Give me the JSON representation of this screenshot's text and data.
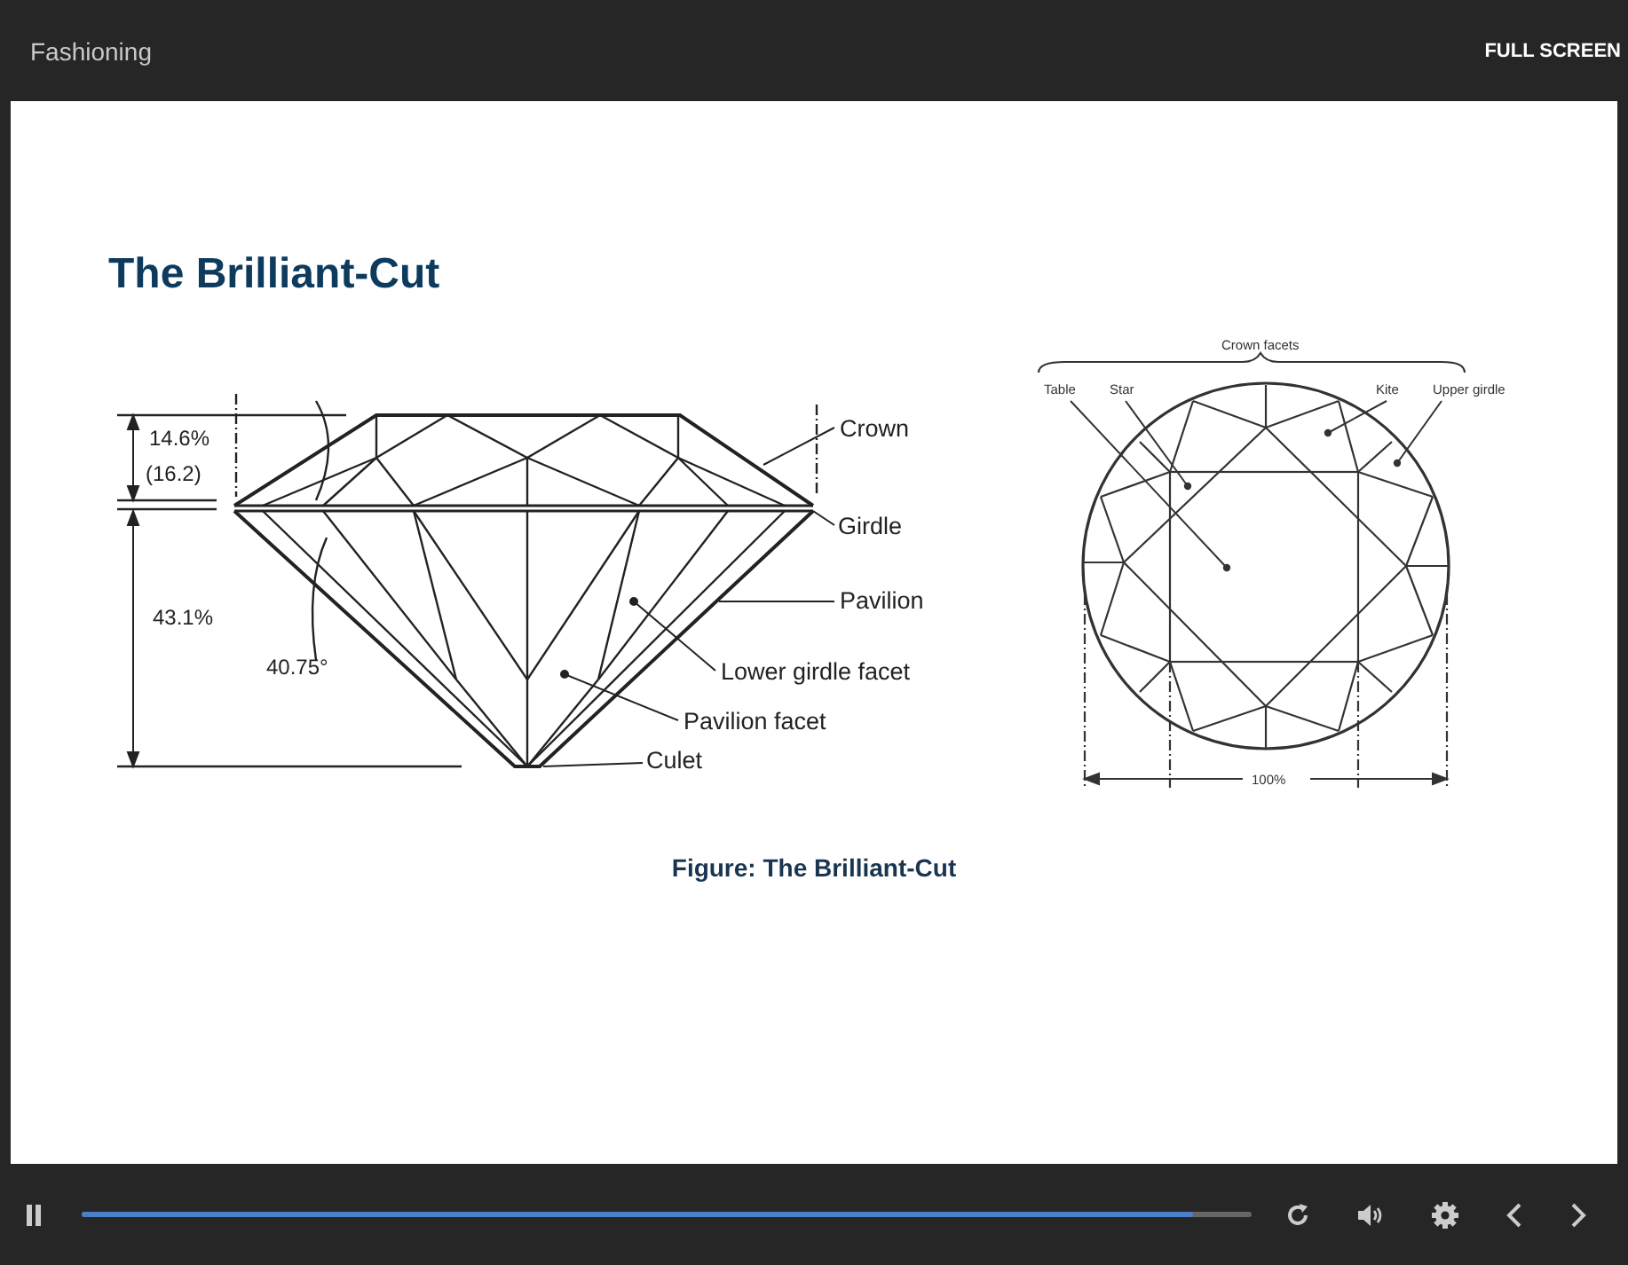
{
  "header": {
    "title": "Fashioning",
    "full_screen": "FULL SCREEN"
  },
  "slide": {
    "title": "The Brilliant-Cut",
    "side_view_labels": [
      "14.6%",
      "(16.2)",
      "43.1%",
      "40.75°",
      "Crown",
      "Girdle",
      "Pavilion",
      "Lower girdle facet",
      "Pavilion facet",
      "Culet"
    ],
    "top_view_labels": [
      "Crown facets",
      "Table",
      "Star",
      "Kite",
      "Upper girdle",
      "100%"
    ],
    "caption": "Figure: The Brilliant-Cut"
  },
  "player": {
    "playing": true,
    "progress": {
      "level": 0.95
    }
  }
}
